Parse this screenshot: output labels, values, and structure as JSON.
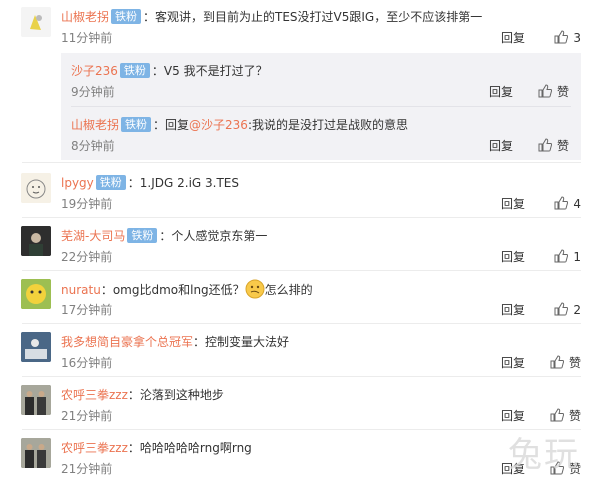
{
  "comments": [
    {
      "user": "山椒老拐",
      "badge": "铁粉",
      "text": "：客观讲，到目前为止的TES没打过V5跟IG，至少不应该排第一",
      "time": "11分钟前",
      "reply": "回复",
      "likes": "3",
      "sub": [
        {
          "user": "沙子236",
          "badge": "铁粉",
          "text": "：V5 我不是打过了？",
          "time": "9分钟前",
          "reply": "回复",
          "likes": "赞"
        },
        {
          "user": "山椒老拐",
          "badge": "铁粉",
          "text_prefix": "：回复",
          "mention": "@沙子236",
          "text": ":我说的是没打过是战败的意思",
          "time": "8分钟前",
          "reply": "回复",
          "likes": "赞"
        }
      ]
    },
    {
      "user": "lpygy",
      "badge": "铁粉",
      "text": "：1.JDG 2.iG 3.TES",
      "time": "19分钟前",
      "reply": "回复",
      "likes": "4"
    },
    {
      "user": "芜湖-大司马",
      "badge": "铁粉",
      "text": "：个人感觉京东第一",
      "time": "22分钟前",
      "reply": "回复",
      "likes": "1"
    },
    {
      "user": "nuratu",
      "text": "：omg比dmo和lng还低？",
      "text_after": "怎么排的",
      "time": "17分钟前",
      "reply": "回复",
      "likes": "2"
    },
    {
      "user": "我多想简自豪拿个总冠军",
      "text": "：控制变量大法好",
      "time": "16分钟前",
      "reply": "回复",
      "likes": "赞"
    },
    {
      "user": "农呼三拳zzz",
      "text": "：沦落到这种地步",
      "time": "21分钟前",
      "reply": "回复",
      "likes": "赞"
    },
    {
      "user": "农呼三拳zzz",
      "text": "：哈哈哈哈哈rng啊rng",
      "time": "21分钟前",
      "reply": "回复",
      "likes": "赞"
    }
  ],
  "watermark": "兔玩",
  "colors": {
    "username": "#eb7350",
    "badge": "#7eb4e5",
    "time": "#808080"
  }
}
